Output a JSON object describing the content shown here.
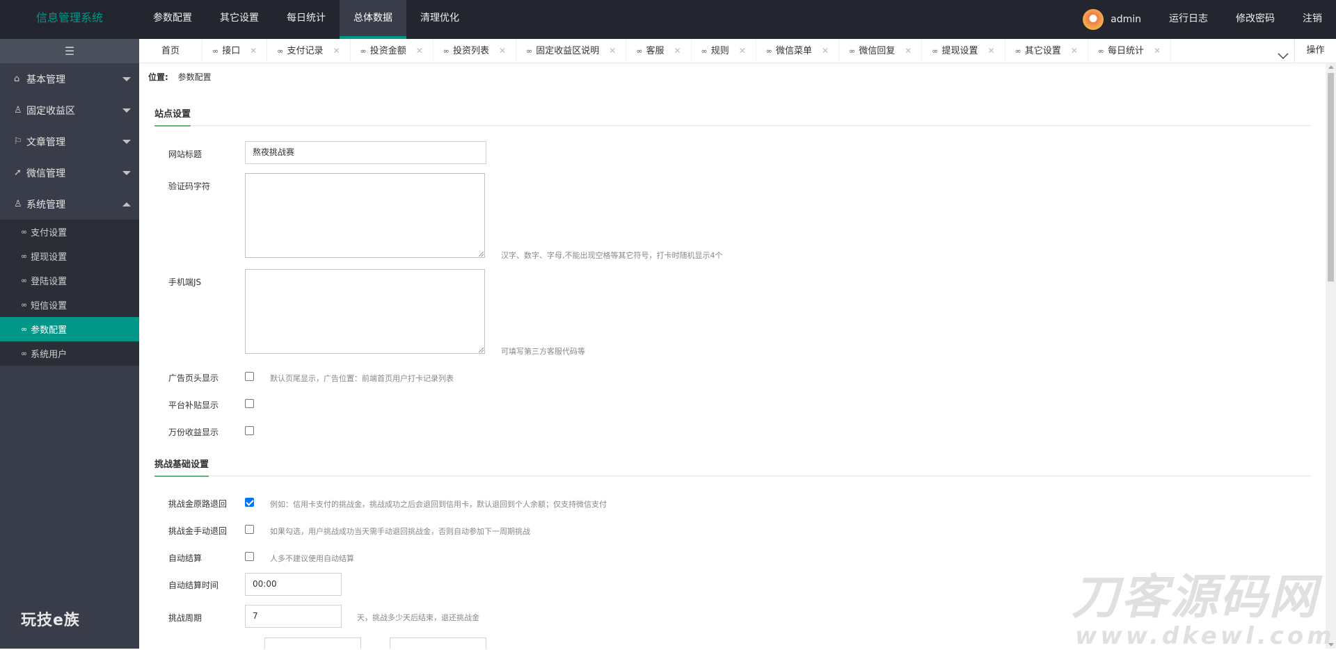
{
  "header": {
    "logo": "信息管理系统",
    "nav": [
      {
        "label": "参数配置",
        "active": false
      },
      {
        "label": "其它设置",
        "active": false
      },
      {
        "label": "每日统计",
        "active": false
      },
      {
        "label": "总体数据",
        "active": true
      },
      {
        "label": "清理优化",
        "active": false
      }
    ],
    "username": "admin",
    "links": {
      "log": "运行日志",
      "password": "修改密码",
      "logout": "注销"
    }
  },
  "sidebar": {
    "groups": [
      {
        "label": "基本管理",
        "icon": "home-icon"
      },
      {
        "label": "固定收益区",
        "icon": "user-group-icon"
      },
      {
        "label": "文章管理",
        "icon": "flag-icon"
      },
      {
        "label": "微信管理",
        "icon": "send-icon"
      },
      {
        "label": "系统管理",
        "icon": "user-icon"
      }
    ],
    "system_items": [
      {
        "label": "支付设置"
      },
      {
        "label": "提现设置"
      },
      {
        "label": "登陆设置"
      },
      {
        "label": "短信设置"
      },
      {
        "label": "参数配置",
        "active": true
      },
      {
        "label": "系统用户"
      }
    ],
    "brand": "玩技e族"
  },
  "tabs": {
    "home": "首页",
    "items": [
      "接口",
      "支付记录",
      "投资金额",
      "投资列表",
      "固定收益区说明",
      "客服",
      "规则",
      "微信菜单",
      "微信回复",
      "提现设置",
      "其它设置",
      "每日统计"
    ],
    "operation": "操作"
  },
  "breadcrumb": {
    "label": "位置:",
    "current": "参数配置"
  },
  "site_settings": {
    "title": "站点设置",
    "site_title_label": "网站标题",
    "site_title_value": "熬夜挑战赛",
    "captcha_label": "验证码字符",
    "captcha_hint": "汉字、数字、字母,不能出现空格等其它符号，打卡时随机显示4个",
    "mobile_js_label": "手机端JS",
    "mobile_js_hint": "可填写第三方客服代码等",
    "ad_header_label": "广告页头显示",
    "ad_header_hint": "默认页尾显示，广告位置：前端首页用户打卡记录列表",
    "subsidy_label": "平台补贴显示",
    "income_label": "万份收益显示"
  },
  "challenge_settings": {
    "title": "挑战基础设置",
    "refund_label": "挑战金原路退回",
    "refund_checked": true,
    "refund_hint": "例如：信用卡支付的挑战金，挑战成功之后会退回到信用卡，默认退回到个人余额；仅支持微信支付",
    "manual_label": "挑战金手动退回",
    "manual_hint": "如果勾选，用户挑战成功当天需手动退回挑战金，否则自动参加下一周期挑战",
    "auto_label": "自动结算",
    "auto_hint": "人多不建议使用自动结算",
    "auto_time_label": "自动结算时间",
    "auto_time_value": "00:00",
    "cycle_label": "挑战周期",
    "cycle_value": "7",
    "cycle_hint": "天，挑战多少天后结束，退还挑战金"
  },
  "watermark": {
    "main": "刀客源码网",
    "sub": "www.dkewl.com"
  },
  "colors": {
    "header_bg": "#23262e",
    "sidebar_bg": "#393d49",
    "accent": "#009688",
    "section_underline": "#5fb878"
  }
}
